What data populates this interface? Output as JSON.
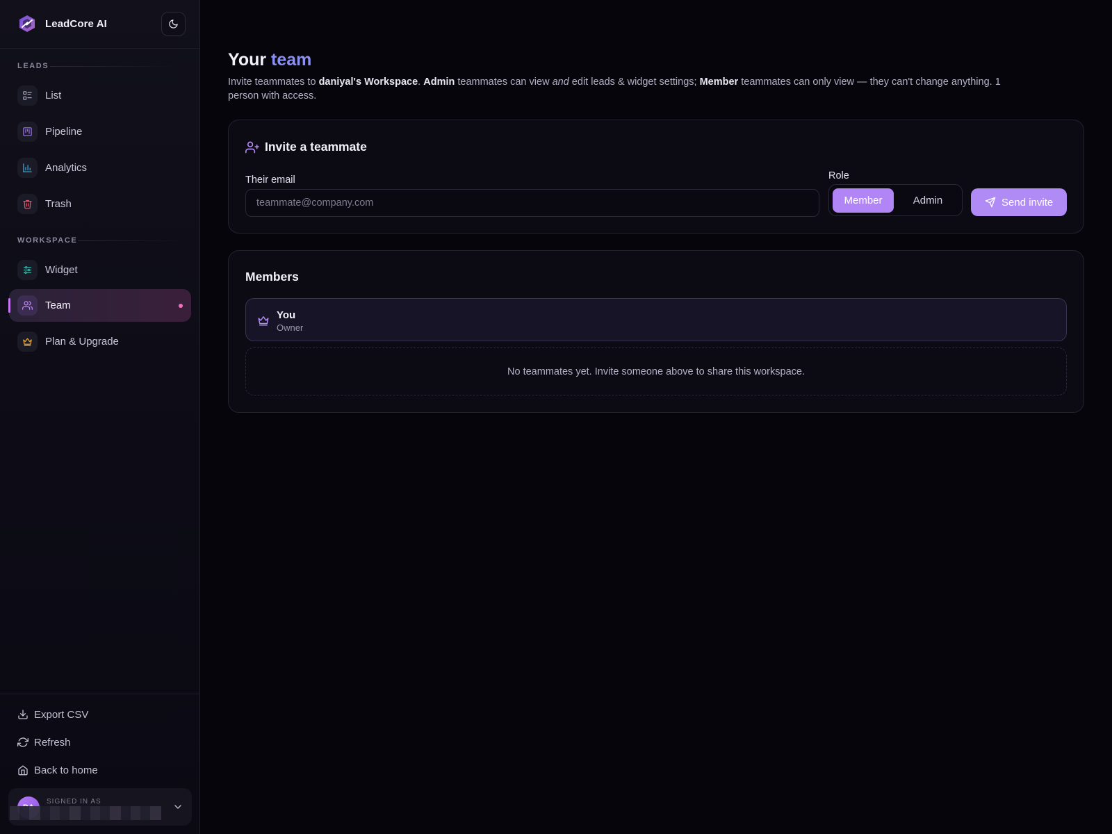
{
  "app": {
    "name": "LeadCore AI"
  },
  "sidebar": {
    "theme_toggle_icon": "moon-icon",
    "sections": [
      {
        "label": "LEADS"
      },
      {
        "label": "WORKSPACE"
      }
    ],
    "items": [
      {
        "label": "List",
        "icon": "list-icon",
        "color": "#a39fb8"
      },
      {
        "label": "Pipeline",
        "icon": "kanban-icon",
        "color": "#9a6cf0"
      },
      {
        "label": "Analytics",
        "icon": "bar-chart-icon",
        "color": "#3aa6d8"
      },
      {
        "label": "Trash",
        "icon": "trash-icon",
        "color": "#e0506a"
      },
      {
        "label": "Widget",
        "icon": "sliders-icon",
        "color": "#2fb3a0"
      },
      {
        "label": "Team",
        "icon": "users-icon",
        "color": "#c58af2",
        "active": true
      },
      {
        "label": "Plan & Upgrade",
        "icon": "crown-icon",
        "color": "#e8a83a"
      }
    ],
    "footer": [
      {
        "label": "Export CSV",
        "icon": "download-icon"
      },
      {
        "label": "Refresh",
        "icon": "refresh-icon"
      },
      {
        "label": "Back to home",
        "icon": "home-icon"
      }
    ],
    "user": {
      "signed_in_label": "SIGNED IN AS",
      "avatar_initials": "DA"
    }
  },
  "page": {
    "title_prefix": "Your",
    "title_accent": "team",
    "description": {
      "t1": "Invite teammates to ",
      "workspace": "daniyal's Workspace",
      "t2": ". ",
      "admin": "Admin",
      "t3": " teammates can view ",
      "and": "and",
      "t4": " edit leads & widget settings; ",
      "member": "Member",
      "t5": " teammates can only view — they can't change anything. 1 person with access."
    }
  },
  "invite": {
    "title": "Invite a teammate",
    "email_label": "Their email",
    "email_placeholder": "teammate@company.com",
    "email_value": "",
    "role_label": "Role",
    "role_options": [
      "Member",
      "Admin"
    ],
    "role_selected": "Member",
    "send_label": "Send invite"
  },
  "members": {
    "title": "Members",
    "list": [
      {
        "name": "You",
        "role": "Owner"
      }
    ],
    "empty_text": "No teammates yet. Invite someone above to share this workspace."
  },
  "colors": {
    "accent": "#b285f7",
    "title_accent": "#8b90f5",
    "active_dot": "#f06fc0",
    "background": "#06050c"
  }
}
